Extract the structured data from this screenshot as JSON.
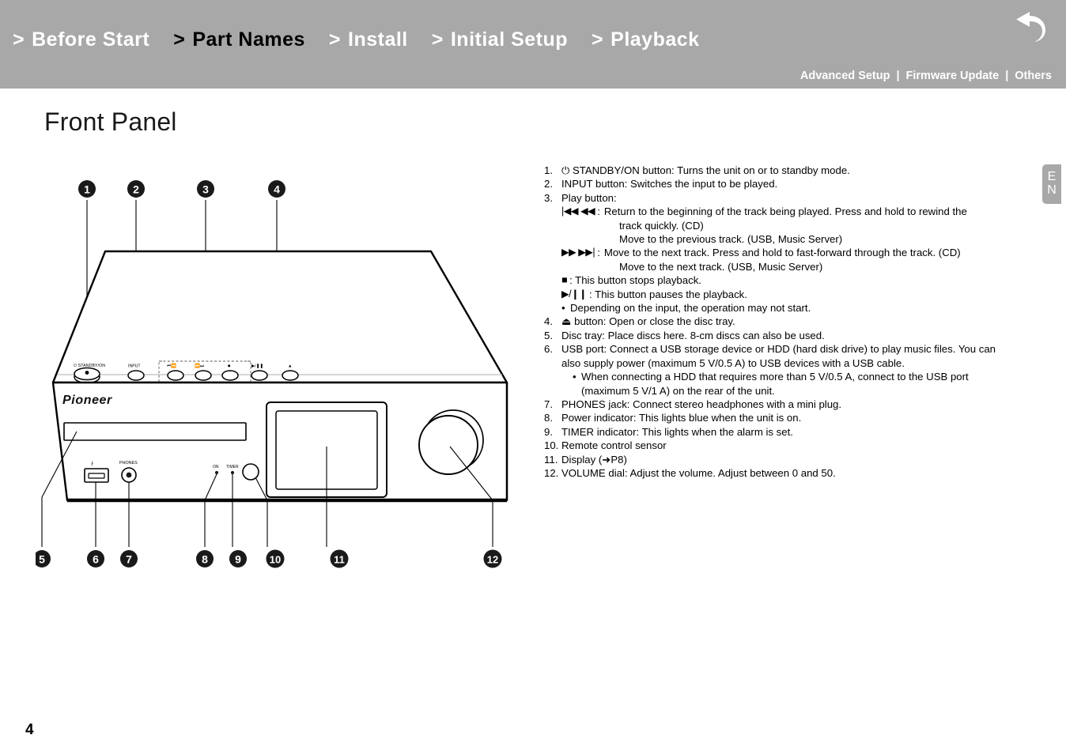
{
  "header": {
    "primary_nav": [
      {
        "chevron": ">",
        "label": "Before Start",
        "active": false
      },
      {
        "chevron": ">",
        "label": "Part Names",
        "active": true
      },
      {
        "chevron": ">",
        "label": "Install",
        "active": false
      },
      {
        "chevron": ">",
        "label": "Initial Setup",
        "active": false
      },
      {
        "chevron": ">",
        "label": "Playback",
        "active": false
      }
    ],
    "secondary_nav": [
      {
        "label": "Advanced Setup"
      },
      {
        "label": "Firmware Update"
      },
      {
        "label": "Others"
      }
    ],
    "separator": "|",
    "back_icon": "back-arrow-icon",
    "bg_color": "#a8a8a8"
  },
  "lang_tab": {
    "line1": "E",
    "line2": "N"
  },
  "page_title": "Front Panel",
  "page_number": "4",
  "diagram": {
    "brand": "Pioneer",
    "top_callouts": [
      "1",
      "2",
      "3",
      "4"
    ],
    "bottom_callouts": [
      "5",
      "6",
      "7",
      "8",
      "9",
      "10",
      "11",
      "12"
    ],
    "panel_labels": {
      "standby": "STANDBY/ON",
      "input": "INPUT",
      "prev": "|◀◀ ◀◀",
      "next": "▶▶ ▶▶|",
      "stop": "■",
      "play_pause": "▶/❙❙",
      "eject": "▲",
      "phones": "PHONES",
      "usb": "USB",
      "on_indicator": "ON",
      "timer_indicator": "TIMER"
    }
  },
  "descriptions": {
    "items": [
      {
        "num": "1.",
        "text": "STANDBY/ON button: Turns the unit on or to standby mode.",
        "prefix_icon": "⏻"
      },
      {
        "num": "2.",
        "text": "INPUT button: Switches the input to be played."
      },
      {
        "num": "3.",
        "text": "Play button:"
      },
      {
        "num": "4.",
        "text": "button: Open or close the disc tray.",
        "prefix_icon": "⏏"
      },
      {
        "num": "5.",
        "text": "Disc tray: Place discs here. 8-cm discs can also be used."
      },
      {
        "num": "6.",
        "text": "USB port: Connect a USB storage device or HDD (hard disk drive) to play music files. You can also supply power (maximum 5 V/0.5 A) to USB devices with a USB cable."
      },
      {
        "num": "7.",
        "text": "PHONES jack: Connect stereo headphones with a mini plug."
      },
      {
        "num": "8.",
        "text": "Power indicator: This lights blue when the unit is on."
      },
      {
        "num": "9.",
        "text": "TIMER indicator: This lights when the alarm is set."
      },
      {
        "num": "10.",
        "text": "Remote control sensor"
      },
      {
        "num": "11.",
        "text": "Display (➜P8)"
      },
      {
        "num": "12.",
        "text": "VOLUME dial: Adjust the volume. Adjust between 0 and 50."
      }
    ],
    "play_button_rows": {
      "prev_symbol": "|◀◀ ◀◀",
      "prev_colon": ":",
      "prev_line1": "Return to the beginning of the track being played. Press and hold to rewind the",
      "prev_line2": "track quickly. (CD)",
      "prev_line3": "Move to the previous track. (USB, Music Server)",
      "next_symbol": "▶▶ ▶▶|",
      "next_colon": ":",
      "next_line1": "Move to the next track. Press and hold to fast-forward through the track. (CD)",
      "next_line2": "Move to the next track. (USB, Music Server)",
      "stop_symbol": "■",
      "stop_text": ": This button stops playback.",
      "pause_symbol": "▶/❙❙",
      "pause_text": ": This button pauses the playback.",
      "note_bullet": "•",
      "note_text": "Depending on the input, the operation may not start."
    },
    "usb_note": {
      "bullet": "•",
      "line1": "When connecting a HDD that requires more than 5 V/0.5 A, connect to the USB port",
      "line2": "(maximum 5 V/1 A) on the rear of the unit."
    },
    "usb_continued": "also supply power (maximum 5 V/0.5 A) to USB devices with a USB cable.",
    "usb_first": "USB port: Connect a USB storage device or HDD (hard disk drive) to play music files. You can"
  }
}
